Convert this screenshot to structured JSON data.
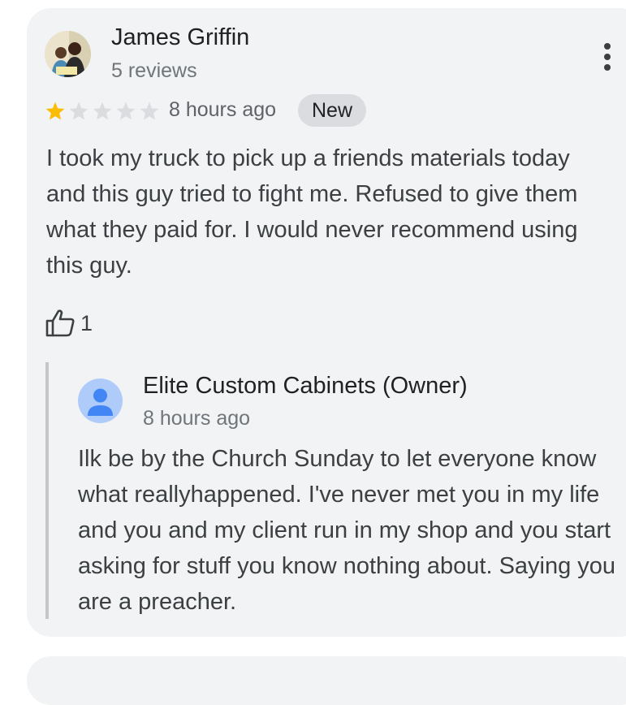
{
  "review": {
    "reviewer_name": "James Griffin",
    "reviewer_meta": "5 reviews",
    "rating": 1,
    "rating_max": 5,
    "time_ago": "8 hours ago",
    "badge": "New",
    "text": "I took my truck to pick up a friends materials today and this guy tried to fight me. Refused to give them what they paid for. I would never recommend using this guy.",
    "like_count": "1",
    "icons": {
      "avatar": "reviewer-photo",
      "menu": "more-vert-icon",
      "like": "thumbs-up-icon",
      "star_filled": "star-icon",
      "star_empty": "star-outline-icon"
    }
  },
  "owner_reply": {
    "name": "Elite Custom Cabinets (Owner)",
    "time_ago": "8 hours ago",
    "text": "Ilk be by the Church Sunday to let everyone know what reallyhappened. I've never met you in my life and you and my client run in my shop and you start asking for stuff you know nothing about. Saying you are a preacher.",
    "icons": {
      "avatar": "owner-avatar-icon"
    }
  },
  "colors": {
    "card_background": "#f1f3f4",
    "star_filled": "#fbbc04",
    "star_empty": "#dadce0",
    "badge_background": "#dadce0",
    "owner_avatar": "#aecbfa",
    "owner_avatar_person": "#4285f4",
    "reply_border": "#c4c6c9"
  }
}
